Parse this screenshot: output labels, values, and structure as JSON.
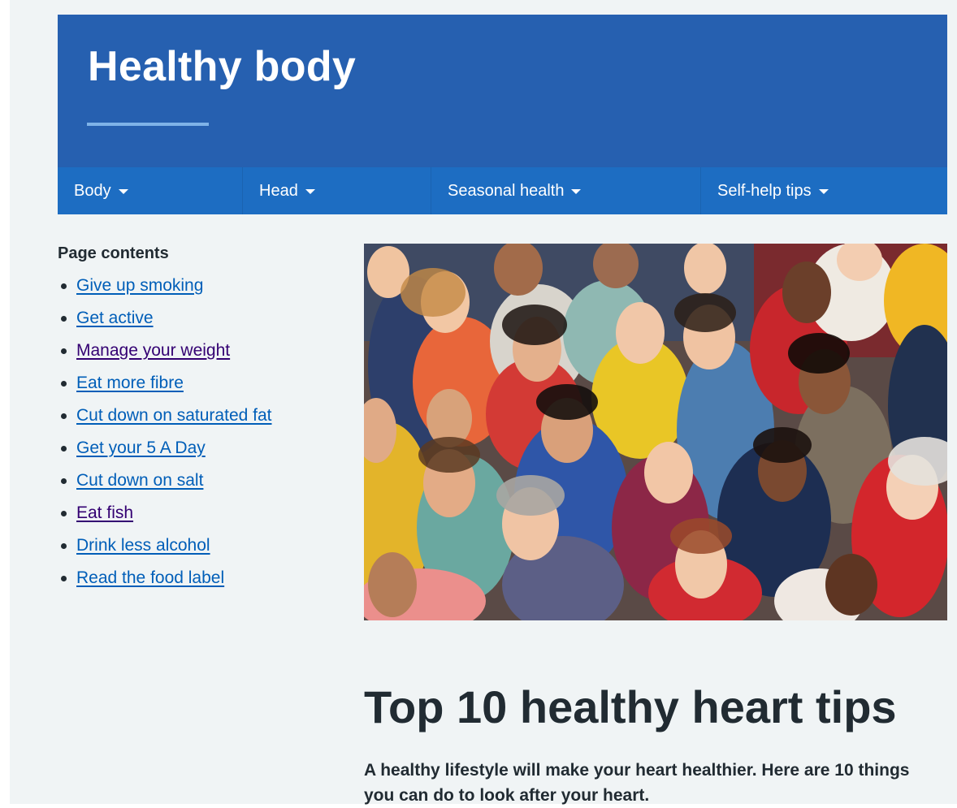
{
  "header": {
    "title": "Healthy body",
    "colors": {
      "header_bg": "#2660b0",
      "nav_bg": "#1d6dc2",
      "underline": "#7fb3e8"
    }
  },
  "nav": {
    "items": [
      {
        "label": "Body",
        "icon": "caret-down-icon"
      },
      {
        "label": "Head",
        "icon": "caret-down-icon"
      },
      {
        "label": "Seasonal health",
        "icon": "caret-down-icon"
      },
      {
        "label": "Self-help tips",
        "icon": "caret-down-icon"
      }
    ]
  },
  "contents": {
    "title": "Page contents",
    "links": [
      {
        "label": "Give up smoking",
        "visited": false
      },
      {
        "label": "Get active",
        "visited": false
      },
      {
        "label": "Manage your weight",
        "visited": true
      },
      {
        "label": "Eat more fibre",
        "visited": false
      },
      {
        "label": "Cut down on saturated fat",
        "visited": false
      },
      {
        "label": "Get your 5 A Day",
        "visited": false
      },
      {
        "label": "Cut down on salt",
        "visited": false
      },
      {
        "label": "Eat fish",
        "visited": true
      },
      {
        "label": "Drink less alcohol",
        "visited": false
      },
      {
        "label": "Read the food label",
        "visited": false
      }
    ],
    "colors": {
      "link": "#005eb8",
      "visited": "#330072"
    }
  },
  "hero": {
    "icon": "crowd-photo"
  },
  "article": {
    "heading": "Top 10 healthy heart tips",
    "lead": "A healthy lifestyle will make your heart healthier. Here are 10 things you can do to look after your heart."
  }
}
